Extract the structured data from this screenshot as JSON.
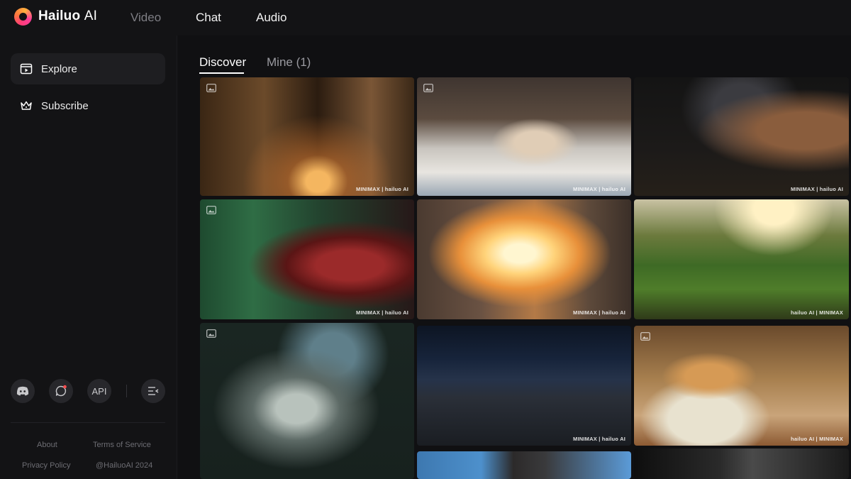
{
  "app": {
    "brand_bold": "Hailuo",
    "brand_light": "AI"
  },
  "topnav": {
    "items": [
      "Video",
      "Chat",
      "Audio"
    ],
    "active": "Video"
  },
  "sidebar": {
    "items": [
      {
        "label": "Explore",
        "icon": "play-calendar-icon",
        "active": true
      },
      {
        "label": "Subscribe",
        "icon": "crown-icon",
        "active": false
      }
    ],
    "buttons": {
      "discord": "discord-icon",
      "chat": "chat-bubble-icon",
      "api": "API",
      "collapse": "collapse-sidebar-icon"
    },
    "footer": {
      "about": "About",
      "terms": "Terms of Service",
      "privacy": "Privacy Policy",
      "copyright": "@HailuoAI 2024"
    }
  },
  "tabs": {
    "discover": "Discover",
    "mine": "Mine (1)"
  },
  "grid": {
    "watermark": "MINIMAX | hailuo AI",
    "watermark_alt": "hailuo AI | MINIMAX",
    "tiles": [
      {
        "desc": "kitten walking in golden light",
        "image_badge": true
      },
      {
        "desc": "puppy on bed with blankets",
        "image_badge": true
      },
      {
        "desc": "armored horse close-up",
        "image_badge": false
      },
      {
        "desc": "man screaming with shadow monster",
        "image_badge": true
      },
      {
        "desc": "explosion between buildings",
        "image_badge": false
      },
      {
        "desc": "woman in garden with dog",
        "image_badge": false
      },
      {
        "desc": "skeleton angel with butterflies",
        "image_badge": true
      },
      {
        "desc": "dark industrial corridor",
        "image_badge": false
      },
      {
        "desc": "hamster eating seeds",
        "image_badge": true
      },
      {
        "desc": "child portrait sky",
        "image_badge": false
      },
      {
        "desc": "dark monochrome scene",
        "image_badge": false
      }
    ]
  },
  "colors": {
    "background": "#101012",
    "sidebar": "#131315",
    "active_item": "#1e1e21",
    "muted_text": "#7e7e84",
    "notification_dot": "#ff4d4f"
  }
}
